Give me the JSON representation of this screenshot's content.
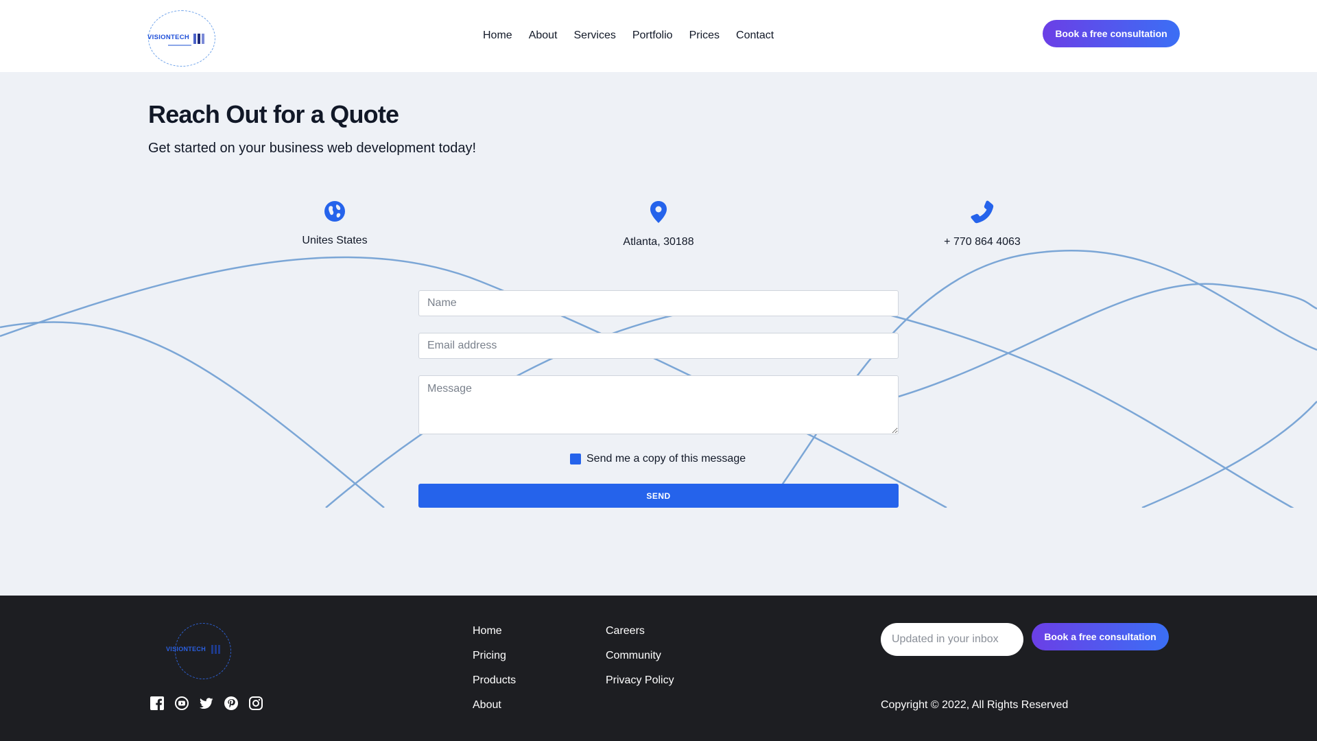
{
  "header": {
    "logo_text": "VISIONTECH",
    "nav": [
      "Home",
      "About",
      "Services",
      "Portfolio",
      "Prices",
      "Contact"
    ],
    "cta_label": "Book a free consultation"
  },
  "hero": {
    "title": "Reach Out for a Quote",
    "subtitle": "Get started on your business web development today!"
  },
  "contact_info": [
    {
      "icon": "globe-icon",
      "text": "Unites States"
    },
    {
      "icon": "location-pin-icon",
      "text": "Atlanta, 30188"
    },
    {
      "icon": "phone-icon",
      "text": "+ 770 864 4063"
    }
  ],
  "form": {
    "name_placeholder": "Name",
    "email_placeholder": "Email address",
    "message_placeholder": "Message",
    "copy_label": "Send me a copy of this message",
    "copy_checked": true,
    "send_label": "SEND"
  },
  "footer": {
    "logo_text": "VISIONTECH",
    "socials": [
      "facebook-icon",
      "youtube-icon",
      "twitter-icon",
      "pinterest-icon",
      "instagram-icon"
    ],
    "col1": [
      "Home",
      "Pricing",
      "Products",
      "About"
    ],
    "col2": [
      "Careers",
      "Community",
      "Privacy Policy"
    ],
    "newsletter_placeholder": "Updated in your inbox",
    "cta_label": "Book a free consultation",
    "copyright": "Copyright © 2022, All Rights Reserved"
  },
  "colors": {
    "accent": "#2563eb",
    "gradient_start": "#6b3fe6",
    "gradient_end": "#3b6ff5",
    "page_bg": "#eef1f6",
    "footer_bg": "#1d1e22"
  }
}
